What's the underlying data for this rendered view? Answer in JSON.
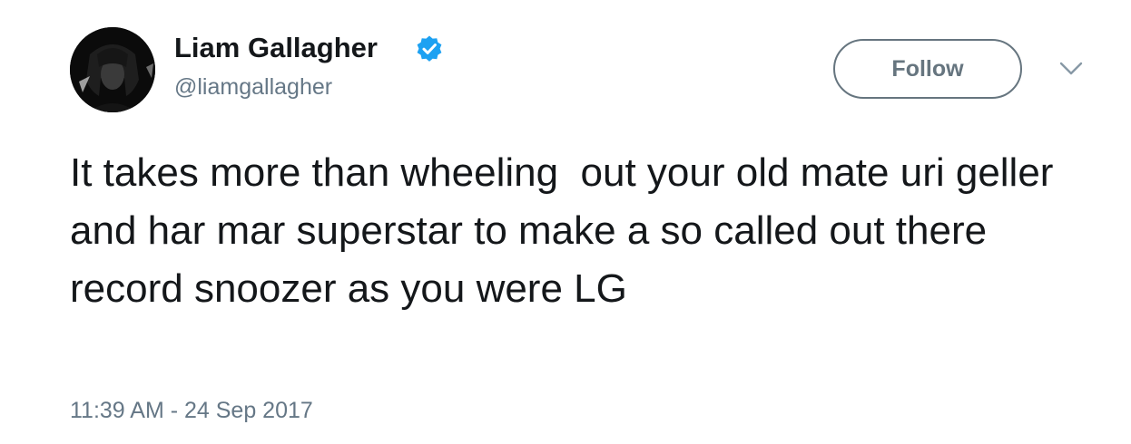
{
  "author": {
    "display_name": "Liam Gallagher",
    "handle": "@liamgallagher",
    "verified": true,
    "avatar_icon": "profile-photo"
  },
  "actions": {
    "follow_label": "Follow",
    "more_icon": "chevron-down-icon"
  },
  "tweet": {
    "text": "It takes more than wheeling  out your old mate uri geller and har mar superstar to make a so called out there record snoozer as you were LG",
    "timestamp": "11:39 AM - 24 Sep 2017"
  },
  "colors": {
    "text_primary": "#14171a",
    "text_secondary": "#657786",
    "button_border": "#66757f",
    "verified_badge": "#1da1f2",
    "background": "#ffffff"
  }
}
